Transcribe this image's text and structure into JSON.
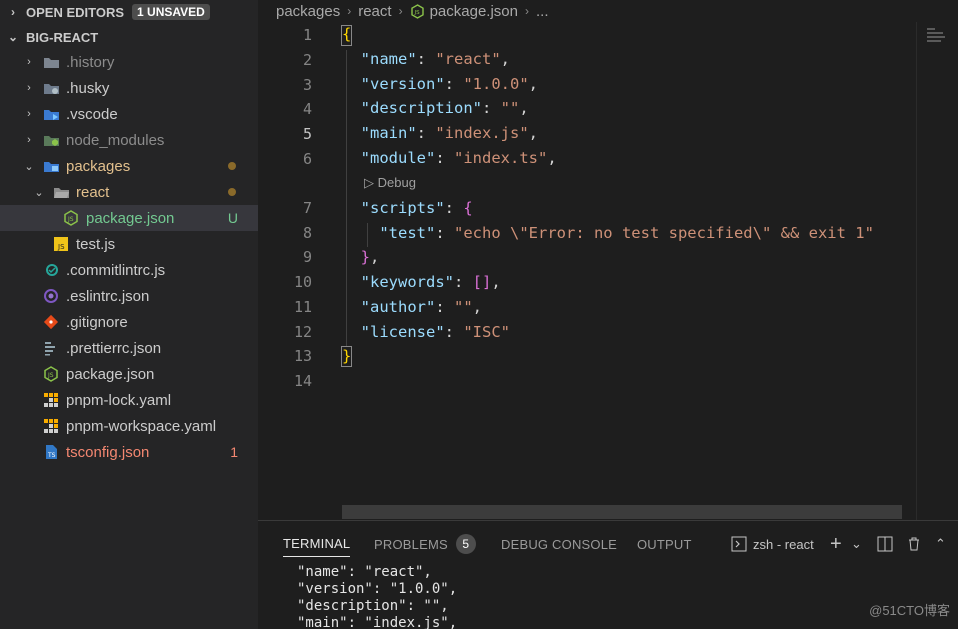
{
  "sidebar": {
    "open_editors": {
      "label": "OPEN EDITORS",
      "badge": "1 UNSAVED"
    },
    "project": {
      "label": "BIG-REACT"
    },
    "items": [
      {
        "label": ".history",
        "icon": "folder-icon",
        "kind": "folder"
      },
      {
        "label": ".husky",
        "icon": "folder-husky-icon",
        "kind": "folder"
      },
      {
        "label": ".vscode",
        "icon": "folder-vscode-icon",
        "kind": "folder"
      },
      {
        "label": "node_modules",
        "icon": "folder-node-icon",
        "kind": "folder"
      },
      {
        "label": "packages",
        "icon": "folder-open-icon",
        "kind": "folder-open"
      },
      {
        "label": "react",
        "icon": "folder-open-icon",
        "kind": "folder-open"
      },
      {
        "label": "package.json",
        "icon": "nodejs-icon",
        "decoration": "U"
      },
      {
        "label": "test.js",
        "icon": "js-icon"
      },
      {
        "label": ".commitlintrc.js",
        "icon": "commitlint-icon"
      },
      {
        "label": ".eslintrc.json",
        "icon": "eslint-icon"
      },
      {
        "label": ".gitignore",
        "icon": "git-icon"
      },
      {
        "label": ".prettierrc.json",
        "icon": "prettier-icon"
      },
      {
        "label": "package.json",
        "icon": "nodejs-icon"
      },
      {
        "label": "pnpm-lock.yaml",
        "icon": "pnpm-icon"
      },
      {
        "label": "pnpm-workspace.yaml",
        "icon": "pnpm-icon"
      },
      {
        "label": "tsconfig.json",
        "icon": "typescript-icon",
        "decoration": "1"
      }
    ]
  },
  "editor": {
    "breadcrumb": [
      "packages",
      "react",
      "package.json",
      "..."
    ],
    "line_numbers": [
      "1",
      "2",
      "3",
      "4",
      "5",
      "6",
      "7",
      "8",
      "9",
      "10",
      "11",
      "12",
      "13",
      "14"
    ],
    "codelens": "Debug",
    "code": {
      "l1": "{",
      "l2_key": "\"name\"",
      "l2_val": "\"react\"",
      "l3_key": "\"version\"",
      "l3_val": "\"1.0.0\"",
      "l4_key": "\"description\"",
      "l4_val": "\"\"",
      "l5_key": "\"main\"",
      "l5_val": "\"index.js\"",
      "l6_key": "\"module\"",
      "l6_val": "\"index.ts\"",
      "l7_key": "\"scripts\"",
      "l7_brace": "{",
      "l8_key": "\"test\"",
      "l8_val": "\"echo \\\"Error: no test specified\\\" && exit 1\"",
      "l9": "}",
      "l10_key": "\"keywords\"",
      "l10_val": "[]",
      "l11_key": "\"author\"",
      "l11_val": "\"\"",
      "l12_key": "\"license\"",
      "l12_val": "\"ISC\"",
      "l13": "}"
    }
  },
  "panel": {
    "tabs": [
      "TERMINAL",
      "PROBLEMS",
      "DEBUG CONSOLE",
      "OUTPUT"
    ],
    "problems_count": "5",
    "terminal_name": "zsh - react",
    "terminal_lines": [
      "\"name\": \"react\",",
      "\"version\": \"1.0.0\",",
      "\"description\": \"\",",
      "\"main\": \"index.js\","
    ]
  },
  "watermark": "@51CTO博客",
  "colors": {
    "accent_modified": "#e2c08d",
    "untracked": "#73c991",
    "error": "#f48771"
  }
}
